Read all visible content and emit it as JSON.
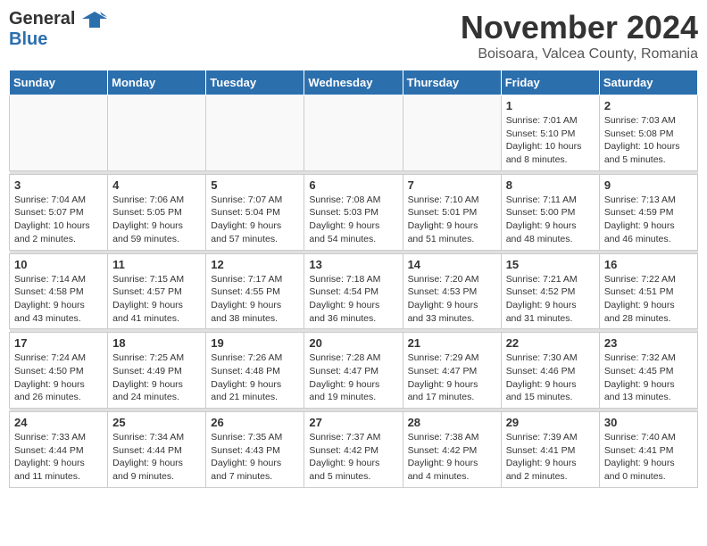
{
  "header": {
    "logo_general": "General",
    "logo_blue": "Blue",
    "month_year": "November 2024",
    "location": "Boisoara, Valcea County, Romania"
  },
  "days_of_week": [
    "Sunday",
    "Monday",
    "Tuesday",
    "Wednesday",
    "Thursday",
    "Friday",
    "Saturday"
  ],
  "weeks": [
    [
      {
        "day": "",
        "info": ""
      },
      {
        "day": "",
        "info": ""
      },
      {
        "day": "",
        "info": ""
      },
      {
        "day": "",
        "info": ""
      },
      {
        "day": "",
        "info": ""
      },
      {
        "day": "1",
        "info": "Sunrise: 7:01 AM\nSunset: 5:10 PM\nDaylight: 10 hours and 8 minutes."
      },
      {
        "day": "2",
        "info": "Sunrise: 7:03 AM\nSunset: 5:08 PM\nDaylight: 10 hours and 5 minutes."
      }
    ],
    [
      {
        "day": "3",
        "info": "Sunrise: 7:04 AM\nSunset: 5:07 PM\nDaylight: 10 hours and 2 minutes."
      },
      {
        "day": "4",
        "info": "Sunrise: 7:06 AM\nSunset: 5:05 PM\nDaylight: 9 hours and 59 minutes."
      },
      {
        "day": "5",
        "info": "Sunrise: 7:07 AM\nSunset: 5:04 PM\nDaylight: 9 hours and 57 minutes."
      },
      {
        "day": "6",
        "info": "Sunrise: 7:08 AM\nSunset: 5:03 PM\nDaylight: 9 hours and 54 minutes."
      },
      {
        "day": "7",
        "info": "Sunrise: 7:10 AM\nSunset: 5:01 PM\nDaylight: 9 hours and 51 minutes."
      },
      {
        "day": "8",
        "info": "Sunrise: 7:11 AM\nSunset: 5:00 PM\nDaylight: 9 hours and 48 minutes."
      },
      {
        "day": "9",
        "info": "Sunrise: 7:13 AM\nSunset: 4:59 PM\nDaylight: 9 hours and 46 minutes."
      }
    ],
    [
      {
        "day": "10",
        "info": "Sunrise: 7:14 AM\nSunset: 4:58 PM\nDaylight: 9 hours and 43 minutes."
      },
      {
        "day": "11",
        "info": "Sunrise: 7:15 AM\nSunset: 4:57 PM\nDaylight: 9 hours and 41 minutes."
      },
      {
        "day": "12",
        "info": "Sunrise: 7:17 AM\nSunset: 4:55 PM\nDaylight: 9 hours and 38 minutes."
      },
      {
        "day": "13",
        "info": "Sunrise: 7:18 AM\nSunset: 4:54 PM\nDaylight: 9 hours and 36 minutes."
      },
      {
        "day": "14",
        "info": "Sunrise: 7:20 AM\nSunset: 4:53 PM\nDaylight: 9 hours and 33 minutes."
      },
      {
        "day": "15",
        "info": "Sunrise: 7:21 AM\nSunset: 4:52 PM\nDaylight: 9 hours and 31 minutes."
      },
      {
        "day": "16",
        "info": "Sunrise: 7:22 AM\nSunset: 4:51 PM\nDaylight: 9 hours and 28 minutes."
      }
    ],
    [
      {
        "day": "17",
        "info": "Sunrise: 7:24 AM\nSunset: 4:50 PM\nDaylight: 9 hours and 26 minutes."
      },
      {
        "day": "18",
        "info": "Sunrise: 7:25 AM\nSunset: 4:49 PM\nDaylight: 9 hours and 24 minutes."
      },
      {
        "day": "19",
        "info": "Sunrise: 7:26 AM\nSunset: 4:48 PM\nDaylight: 9 hours and 21 minutes."
      },
      {
        "day": "20",
        "info": "Sunrise: 7:28 AM\nSunset: 4:47 PM\nDaylight: 9 hours and 19 minutes."
      },
      {
        "day": "21",
        "info": "Sunrise: 7:29 AM\nSunset: 4:47 PM\nDaylight: 9 hours and 17 minutes."
      },
      {
        "day": "22",
        "info": "Sunrise: 7:30 AM\nSunset: 4:46 PM\nDaylight: 9 hours and 15 minutes."
      },
      {
        "day": "23",
        "info": "Sunrise: 7:32 AM\nSunset: 4:45 PM\nDaylight: 9 hours and 13 minutes."
      }
    ],
    [
      {
        "day": "24",
        "info": "Sunrise: 7:33 AM\nSunset: 4:44 PM\nDaylight: 9 hours and 11 minutes."
      },
      {
        "day": "25",
        "info": "Sunrise: 7:34 AM\nSunset: 4:44 PM\nDaylight: 9 hours and 9 minutes."
      },
      {
        "day": "26",
        "info": "Sunrise: 7:35 AM\nSunset: 4:43 PM\nDaylight: 9 hours and 7 minutes."
      },
      {
        "day": "27",
        "info": "Sunrise: 7:37 AM\nSunset: 4:42 PM\nDaylight: 9 hours and 5 minutes."
      },
      {
        "day": "28",
        "info": "Sunrise: 7:38 AM\nSunset: 4:42 PM\nDaylight: 9 hours and 4 minutes."
      },
      {
        "day": "29",
        "info": "Sunrise: 7:39 AM\nSunset: 4:41 PM\nDaylight: 9 hours and 2 minutes."
      },
      {
        "day": "30",
        "info": "Sunrise: 7:40 AM\nSunset: 4:41 PM\nDaylight: 9 hours and 0 minutes."
      }
    ]
  ]
}
